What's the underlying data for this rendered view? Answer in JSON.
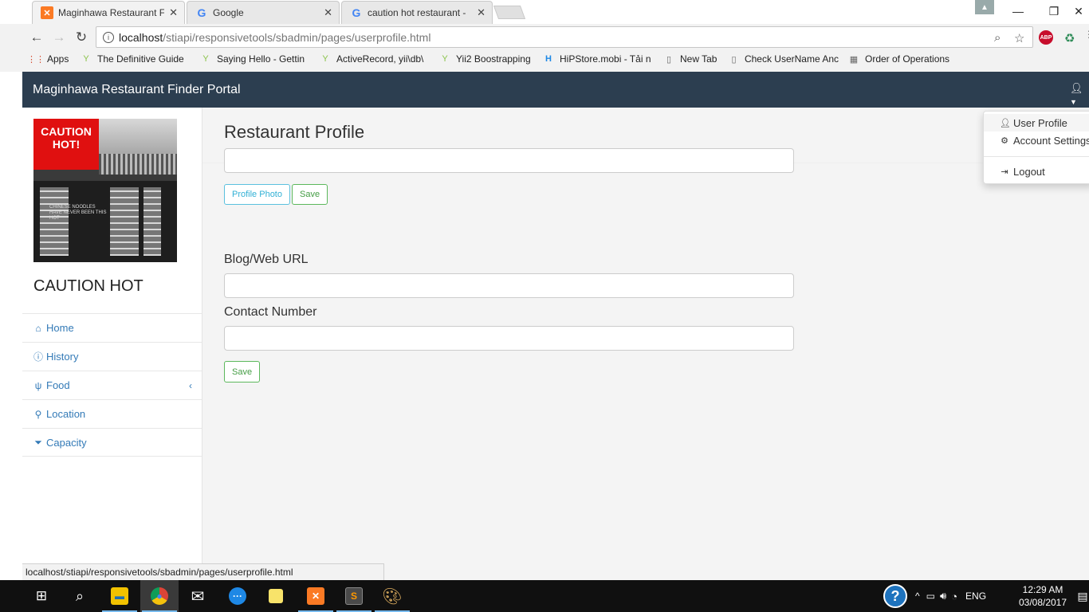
{
  "browser": {
    "tabs": [
      {
        "title": "Maginhawa Restaurant F",
        "favicon": "xampp-icon",
        "color": "#fb7a24"
      },
      {
        "title": "Google",
        "favicon": "google-icon",
        "color": "#4285f4"
      },
      {
        "title": "caution hot restaurant - ",
        "favicon": "google-icon",
        "color": "#4285f4"
      }
    ],
    "tab_close": "✕",
    "address": {
      "host": "localhost",
      "path": "/stiapi/responsivetools/sbadmin/pages/userprofile.html"
    },
    "abp_label": "ABP",
    "bookmarks": [
      {
        "label": "Apps",
        "icon": "apps-grid-icon"
      },
      {
        "label": "The Definitive Guide",
        "icon": "yii-icon"
      },
      {
        "label": "Saying Hello - Gettin",
        "icon": "yii-icon"
      },
      {
        "label": "ActiveRecord, yii\\db\\",
        "icon": "yii-icon"
      },
      {
        "label": "Yii2 Boostrapping",
        "icon": "yii-icon"
      },
      {
        "label": "HiPStore.mobi - Tải n",
        "icon": "hipstore-icon"
      },
      {
        "label": "New Tab",
        "icon": "page-icon"
      },
      {
        "label": "Check UserName Anc",
        "icon": "page-icon"
      },
      {
        "label": "Order of Operations",
        "icon": "calculator-icon"
      }
    ],
    "status_url": "localhost/stiapi/responsivetools/sbadmin/pages/userprofile.html"
  },
  "app": {
    "brand": "Maginhawa Restaurant Finder Portal",
    "restaurant_name": "CAUTION HOT",
    "photo_sign_text": "CAUTION HOT!",
    "photo_window_text": "CHINESE NOODLES HAVE NEVER BEEN THIS HOT",
    "menu": [
      {
        "label": "Home",
        "icon": "home-icon"
      },
      {
        "label": "History",
        "icon": "info-circle-icon"
      },
      {
        "label": "Food",
        "icon": "cutlery-icon",
        "has_submenu": true
      },
      {
        "label": "Location",
        "icon": "map-marker-icon"
      },
      {
        "label": "Capacity",
        "icon": "filter-icon"
      }
    ],
    "submenu_arrow": "‹",
    "page_title": "Restaurant Profile",
    "profile_photo_button": "Profile Photo",
    "save_button": "Save",
    "blog_label": "Blog/Web URL",
    "contact_label": "Contact Number",
    "save_button_2": "Save",
    "user_dropdown": [
      {
        "label": "User Profile",
        "icon": "user-icon"
      },
      {
        "label": "Account Settings",
        "icon": "gear-icon"
      },
      {
        "label": "Logout",
        "icon": "sign-out-icon"
      }
    ]
  },
  "taskbar": {
    "time": "12:29 AM",
    "date": "03/08/2017",
    "language": "ENG"
  },
  "colors": {
    "navbar": "#2c3e50",
    "link": "#337ab7",
    "info": "#5bc0de",
    "success": "#5cb85c"
  }
}
